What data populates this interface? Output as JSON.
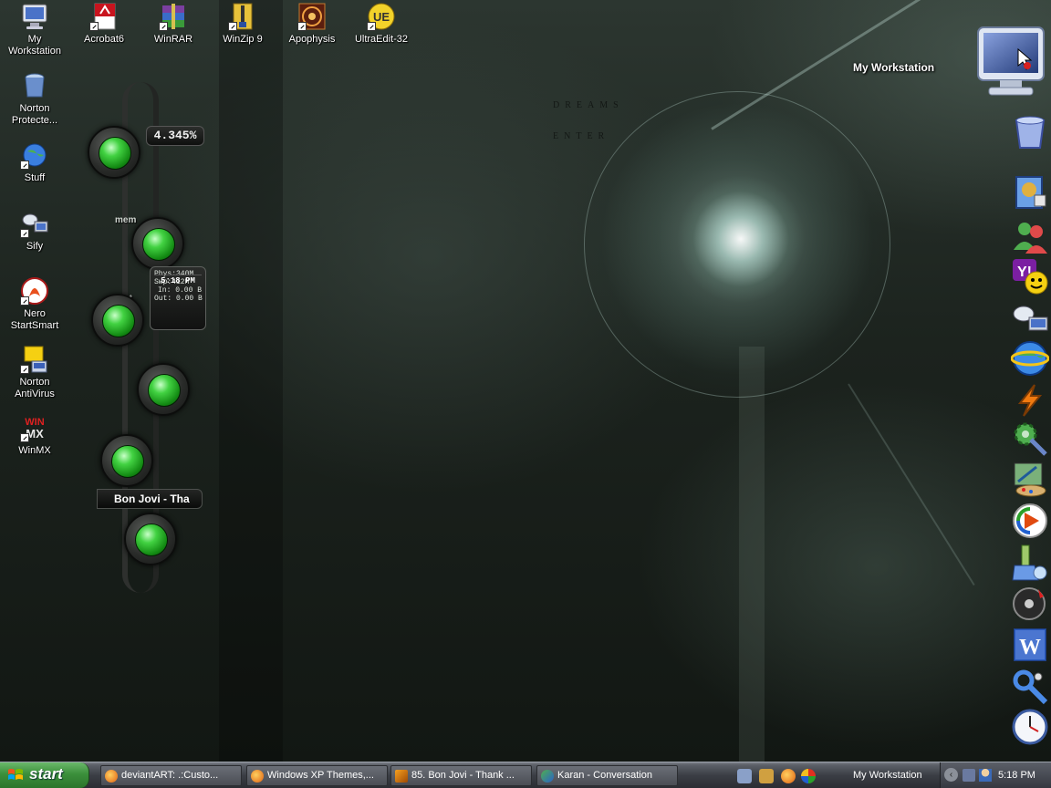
{
  "desktop_icons": [
    {
      "id": "my-workstation",
      "label": "My\nWorkstation",
      "icon": "computer-icon"
    },
    {
      "id": "acrobat6",
      "label": "Acrobat6",
      "icon": "acrobat-icon"
    },
    {
      "id": "winrar",
      "label": "WinRAR",
      "icon": "winrar-icon"
    },
    {
      "id": "winzip9",
      "label": "WinZip 9",
      "icon": "winzip-icon"
    },
    {
      "id": "apophysis",
      "label": "Apophysis",
      "icon": "apophysis-icon"
    },
    {
      "id": "ultraedit32",
      "label": "UltraEdit-32",
      "icon": "ultraedit-icon"
    },
    {
      "id": "norton-protected",
      "label": "Norton\nProtecte...",
      "icon": "norton-bin-icon"
    },
    {
      "id": "stuff",
      "label": "Stuff",
      "icon": "globe-icon"
    },
    {
      "id": "sify",
      "label": "Sify",
      "icon": "satellite-icon"
    },
    {
      "id": "nero-startsmart",
      "label": "Nero\nStartSmart",
      "icon": "nero-icon"
    },
    {
      "id": "norton-antivirus",
      "label": "Norton\nAntiVirus",
      "icon": "norton-antivirus-icon"
    },
    {
      "id": "winmx",
      "label": "WinMX",
      "icon": "winmx-icon"
    }
  ],
  "wallpaper": {
    "text_top": "DREAMS",
    "text_second": "ENTER"
  },
  "monitor_widget": {
    "cpu": "4.345%",
    "mem_label": "mem",
    "net_label": "net",
    "phys": "Phys:340M",
    "swp": "Swp:412M",
    "net_in": "In: 0.00 B",
    "net_out": "Out: 0.00 B",
    "time": "5:18 PM",
    "now_playing": "Bon Jovi - Tha"
  },
  "dock": {
    "title": "My Workstation",
    "items": [
      "recycle-bin-icon",
      "photo-viewer-icon",
      "messenger-icon",
      "yahoo-messenger-icon",
      "satellite-icon",
      "internet-explorer-icon",
      "winamp-icon",
      "settings-icon",
      "paint-icon",
      "media-player-icon",
      "cleaner-icon",
      "cd-player-icon",
      "word-icon",
      "tools-icon",
      "clock-icon"
    ]
  },
  "taskbar": {
    "start_label": "start",
    "tasks": [
      {
        "label": "deviantART: .:Custo...",
        "icon": "firefox-icon"
      },
      {
        "label": "Windows XP Themes,...",
        "icon": "firefox-icon"
      },
      {
        "label": "85. Bon Jovi - Thank ...",
        "icon": "winamp-icon"
      },
      {
        "label": "Karan - Conversation",
        "icon": "messenger-icon"
      }
    ],
    "toolbar_label": "My Workstation",
    "clock": "5:18 PM",
    "tray_arrow": "‹"
  },
  "colors": {
    "orb_green": "#42d242",
    "start_green": "#3b8f3b",
    "taskbar_gray": "#3b3e45"
  }
}
